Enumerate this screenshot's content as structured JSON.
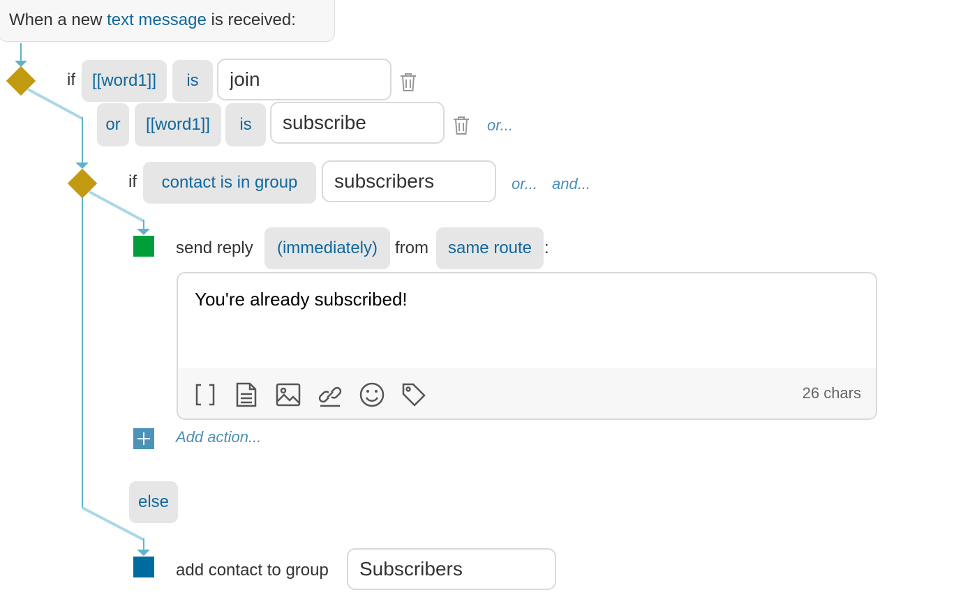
{
  "trigger": {
    "prefix": "When a new",
    "link": "text message",
    "suffix": "is received:"
  },
  "condition1": {
    "if_label": "if",
    "row1": {
      "field": "[[word1]]",
      "op": "is",
      "value": "join"
    },
    "row2": {
      "or_label": "or",
      "field": "[[word1]]",
      "op": "is",
      "value": "subscribe",
      "or_link": "or..."
    }
  },
  "condition2": {
    "if_label": "if",
    "field": "contact is in group",
    "value": "subscribers",
    "or_link": "or...",
    "and_link": "and..."
  },
  "action_reply": {
    "prefix": "send reply",
    "timing": "(immediately)",
    "from_label": "from",
    "route": "same route",
    "colon": ":",
    "message": "You're already subscribed!",
    "char_count": "26 chars",
    "tools": [
      "brackets-icon",
      "document-icon",
      "image-icon",
      "link-icon",
      "emoji-icon",
      "tag-icon"
    ]
  },
  "add_action": "Add action...",
  "else_label": "else",
  "action_group": {
    "label": "add contact to group",
    "value": "Subscribers"
  },
  "colors": {
    "diamond": "#c29a10",
    "reply_square": "#009e3a",
    "group_square": "#006b9f",
    "add_square": "#4c93b9",
    "link": "#11689c",
    "connector": "#5fb3c9"
  }
}
